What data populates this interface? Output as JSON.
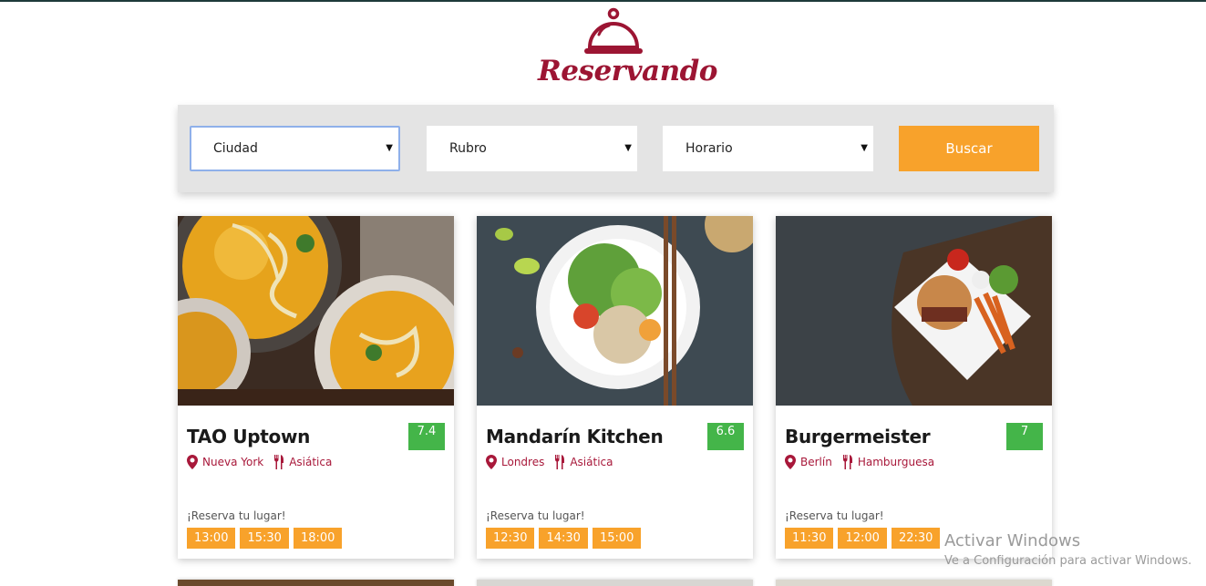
{
  "brand": {
    "name": "Reservando",
    "color": "#9c1533",
    "icon": "cloche-icon"
  },
  "search": {
    "city": {
      "selected": "Ciudad"
    },
    "category": {
      "selected": "Rubro"
    },
    "schedule": {
      "selected": "Horario"
    },
    "submit_label": "Buscar",
    "caret": "▼"
  },
  "restaurants": [
    {
      "name": "TAO Uptown",
      "score": "7.4",
      "city": "Nueva York",
      "category": "Asiática",
      "reserve_label": "¡Reserva tu lugar!",
      "times": [
        "13:00",
        "15:30",
        "18:00"
      ]
    },
    {
      "name": "Mandarín Kitchen",
      "score": "6.6",
      "city": "Londres",
      "category": "Asiática",
      "reserve_label": "¡Reserva tu lugar!",
      "times": [
        "12:30",
        "14:30",
        "15:00"
      ]
    },
    {
      "name": "Burgermeister",
      "score": "7",
      "city": "Berlín",
      "category": "Hamburguesa",
      "reserve_label": "¡Reserva tu lugar!",
      "times": [
        "11:30",
        "12:00",
        "22:30"
      ]
    }
  ],
  "colors": {
    "accent": "#f8a22b",
    "score_bg": "#44b549",
    "meta": "#a8183a"
  },
  "watermark": {
    "title": "Activar Windows",
    "subtitle": "Ve a Configuración para activar Windows."
  }
}
